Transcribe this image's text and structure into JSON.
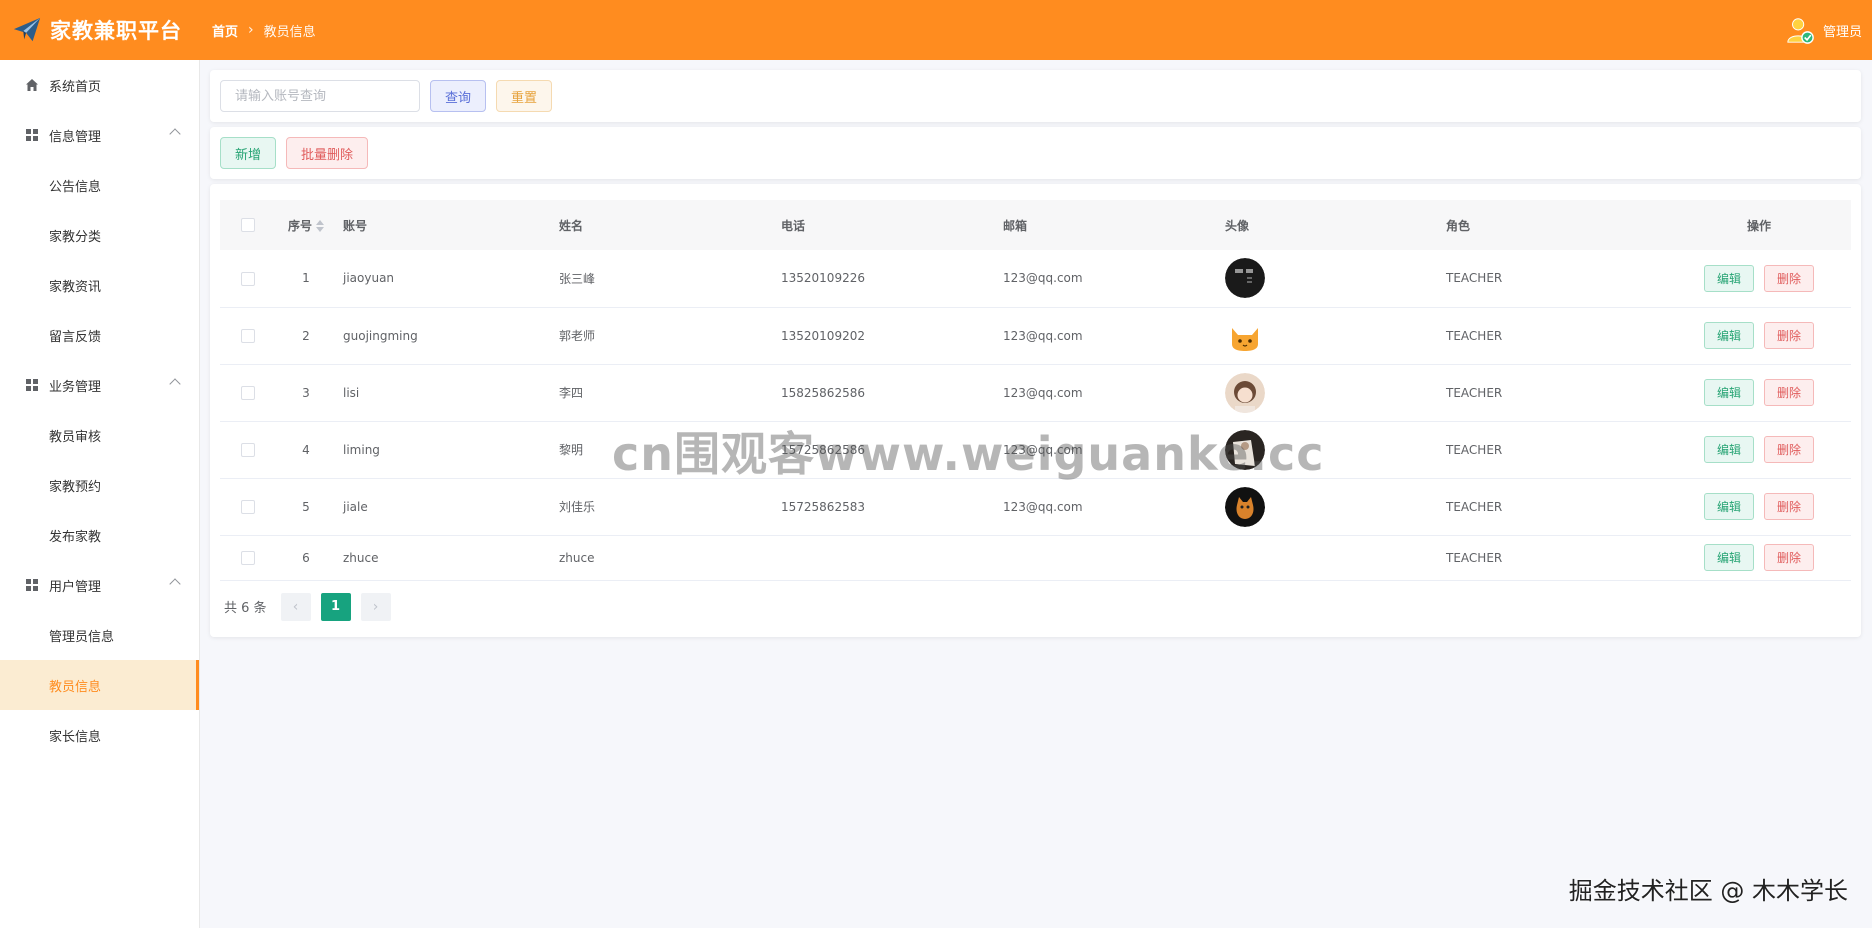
{
  "app": {
    "title": "家教兼职平台"
  },
  "breadcrumb": {
    "home": "首页",
    "current": "教员信息"
  },
  "user": {
    "name": "管理员",
    "icon": "user-admin-icon"
  },
  "sidebar": {
    "home": {
      "label": "系统首页",
      "icon": "home-icon"
    },
    "groups": [
      {
        "label": "信息管理",
        "icon": "grid-icon",
        "items": [
          "公告信息",
          "家教分类",
          "家教资讯",
          "留言反馈"
        ]
      },
      {
        "label": "业务管理",
        "icon": "grid-icon",
        "items": [
          "教员审核",
          "家教预约",
          "发布家教"
        ]
      },
      {
        "label": "用户管理",
        "icon": "grid-icon",
        "items": [
          "管理员信息",
          "教员信息",
          "家长信息"
        ]
      }
    ],
    "active": "教员信息"
  },
  "search": {
    "placeholder": "请输入账号查询",
    "query_label": "查询",
    "reset_label": "重置"
  },
  "toolbar": {
    "add_label": "新增",
    "batch_delete_label": "批量删除"
  },
  "table": {
    "headers": [
      "序号",
      "账号",
      "姓名",
      "电话",
      "邮箱",
      "头像",
      "角色",
      "操作"
    ],
    "edit_label": "编辑",
    "delete_label": "删除",
    "rows": [
      {
        "no": "1",
        "account": "jiaoyuan",
        "name": "张三峰",
        "phone": "13520109226",
        "email": "123@qq.com",
        "avatar": "avatar-dark",
        "role": "TEACHER"
      },
      {
        "no": "2",
        "account": "guojingming",
        "name": "郭老师",
        "phone": "13520109202",
        "email": "123@qq.com",
        "avatar": "avatar-cat",
        "role": "TEACHER"
      },
      {
        "no": "3",
        "account": "lisi",
        "name": "李四",
        "phone": "15825862586",
        "email": "123@qq.com",
        "avatar": "avatar-girl",
        "role": "TEACHER"
      },
      {
        "no": "4",
        "account": "liming",
        "name": "黎明",
        "phone": "15725862586",
        "email": "123@qq.com",
        "avatar": "avatar-person",
        "role": "TEACHER"
      },
      {
        "no": "5",
        "account": "jiale",
        "name": "刘佳乐",
        "phone": "15725862583",
        "email": "123@qq.com",
        "avatar": "avatar-orange",
        "role": "TEACHER"
      },
      {
        "no": "6",
        "account": "zhuce",
        "name": "zhuce",
        "phone": "",
        "email": "",
        "avatar": "",
        "role": "TEACHER"
      }
    ]
  },
  "pagination": {
    "total_label": "共 6 条",
    "current_page": "1"
  },
  "watermark": {
    "text": "cn围观客www.weiguanke.cc"
  },
  "footer_mark": {
    "text": "掘金技术社区 @ 木木学长"
  },
  "colors": {
    "header": "#ff8c1f",
    "active_bg": "#fbecd2",
    "primary_green": "#17a37f"
  }
}
